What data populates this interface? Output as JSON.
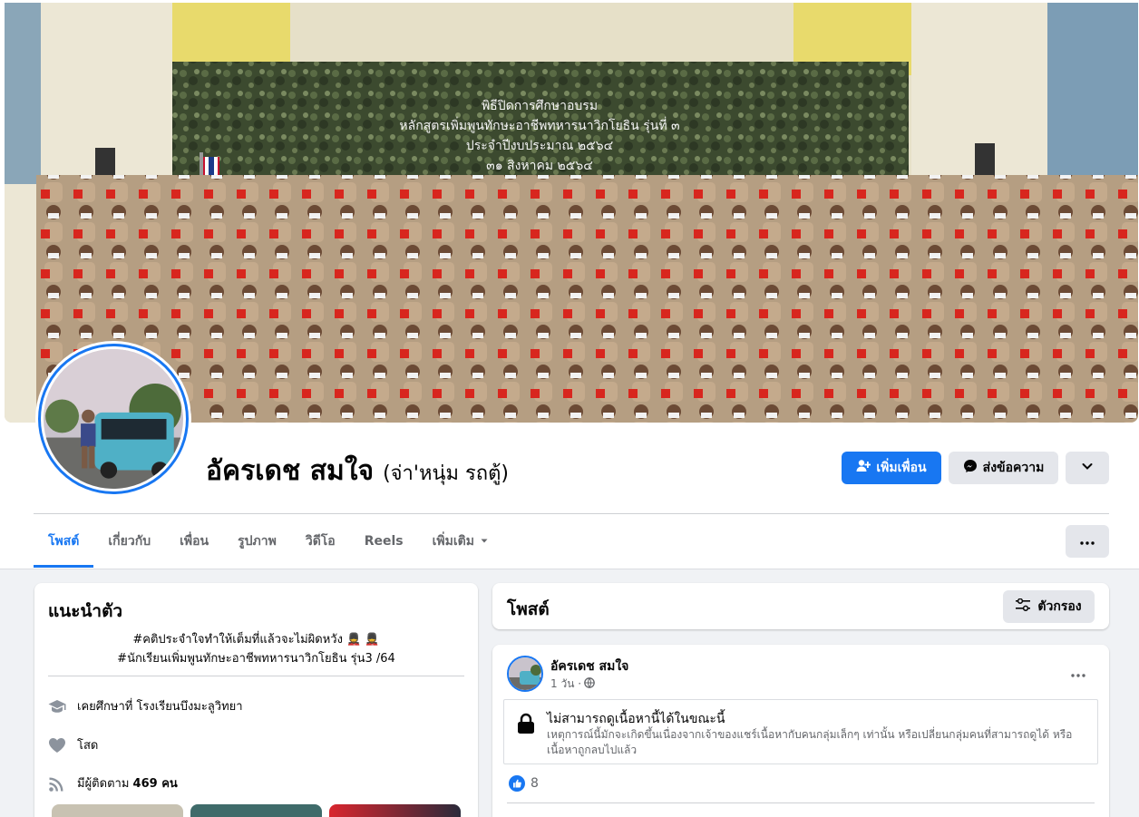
{
  "profile": {
    "name": "อัครเดช สมใจ",
    "nickname": "(จ่า'หนุ่ม รถตู้)"
  },
  "actions": {
    "add_friend": "เพิ่มเพื่อน",
    "message": "ส่งข้อความ"
  },
  "tabs": [
    {
      "label": "โพสต์"
    },
    {
      "label": "เกี่ยวกับ"
    },
    {
      "label": "เพื่อน"
    },
    {
      "label": "รูปภาพ"
    },
    {
      "label": "วิดีโอ"
    },
    {
      "label": "Reels"
    },
    {
      "label": "เพิ่มเติม"
    }
  ],
  "cover_text": {
    "line1": "พิธีปิดการศึกษาอบรม",
    "line2": "หลักสูตรเพิ่มพูนทักษะอาชีพทหารนาวิกโยธิน รุ่นที่ ๓",
    "line3": "ประจำปีงบประมาณ ๒๕๖๔",
    "line4": "๓๑ สิงหาคม ๒๕๖๔"
  },
  "intro": {
    "title": "แนะนำตัว",
    "bio_line1": "#คติประจำใจทำให้เต็มที่แล้วจะไม่ผิดหวัง 💂 💂",
    "bio_line2": "#นักเรียนเพิ่มพูนทักษะอาชีพทหารนาวิกโยธิน รุ่น3 /64",
    "studied": "เคยศึกษาที่ โรงเรียนบึงมะลูวิทยา",
    "relationship": "โสด",
    "followers_prefix": "มีผู้ติดตาม",
    "followers_count": "469 คน"
  },
  "posts_section": {
    "title": "โพสต์",
    "filter": "ตัวกรอง"
  },
  "post": {
    "author": "อัครเดช สมใจ",
    "time": "1 วัน ·",
    "unavailable_title": "ไม่สามารถดูเนื้อหานี้ได้ในขณะนี้",
    "unavailable_desc": "เหตุการณ์นี้มักจะเกิดขึ้นเนื่องจากเจ้าของแชร์เนื้อหากับคนกลุ่มเล็กๆ เท่านั้น หรือเปลี่ยนกลุ่มคนที่สามารถดูได้ หรือเนื้อหาถูกลบไปแล้ว",
    "likes": "8"
  },
  "colors": {
    "accent": "#1877f2",
    "secondary_btn": "#e4e6eb",
    "background": "#f0f2f5"
  }
}
